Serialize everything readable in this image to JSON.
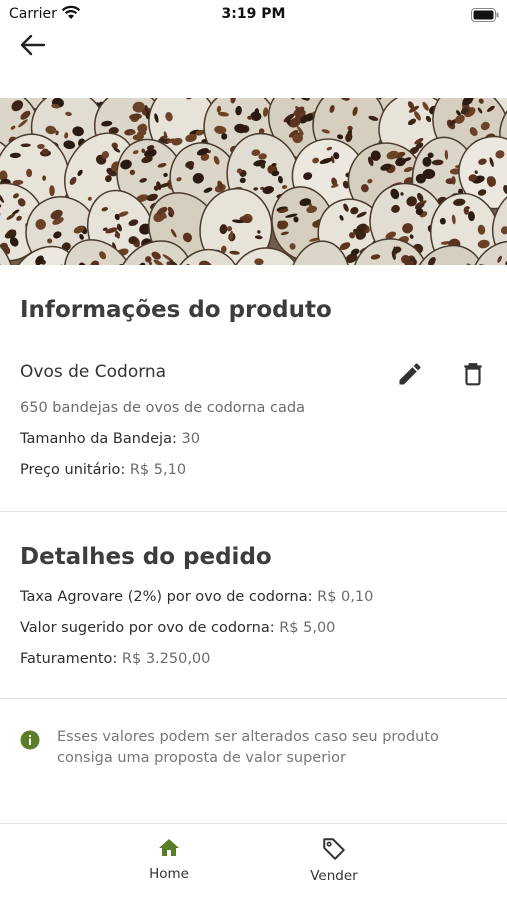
{
  "status_bar": {
    "carrier": "Carrier",
    "time": "3:19 PM"
  },
  "product_info": {
    "title": "Informações do produto",
    "name": "Ovos de Codorna",
    "description": "650 bandejas de ovos de codorna cada",
    "tray_size_label": "Tamanho da Bandeja:",
    "tray_size_value": "30",
    "unit_price_label": "Preço unitário:",
    "unit_price_value": "R$ 5,10"
  },
  "order_details": {
    "title": "Detalhes do pedido",
    "fee_label": "Taxa Agrovare (2%) por ovo de codorna:",
    "fee_value": "R$ 0,10",
    "suggested_label": "Valor sugerido por ovo de codorna:",
    "suggested_value": "R$ 5,00",
    "revenue_label": "Faturamento:",
    "revenue_value": "R$ 3.250,00"
  },
  "notice": {
    "icon": "info-icon",
    "line1": "Esses valores podem ser alterados caso seu produto",
    "line2": "consiga uma proposta de valor superior"
  },
  "bottom_nav": {
    "items": [
      {
        "label": "Home",
        "icon": "home-icon",
        "active": true
      },
      {
        "label": "Vender",
        "icon": "tag-icon",
        "active": false
      }
    ]
  },
  "colors": {
    "accent": "#5a7d2a",
    "text": "#3d3d3d",
    "muted": "#6c6c6c",
    "divider": "#e4e4e4"
  }
}
